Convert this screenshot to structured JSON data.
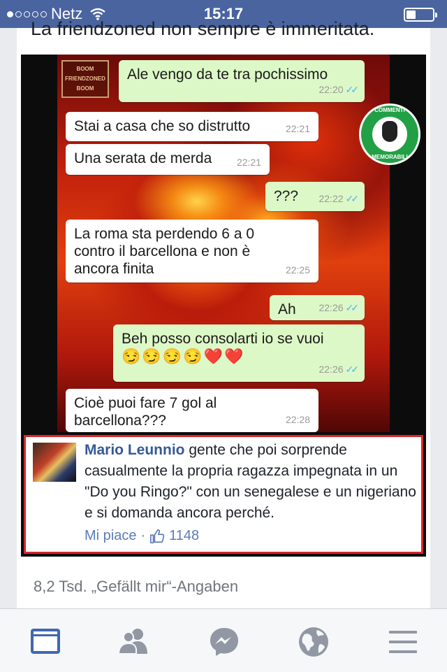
{
  "status_bar": {
    "carrier": "Netz",
    "time": "15:17",
    "signal_bars_filled": 1,
    "signal_bars_total": 5,
    "battery_level": 0.35
  },
  "post": {
    "caption": "La friendzoned non sempre è immeritata."
  },
  "image": {
    "stamp_text": "BOOM FRIENDZONED BOOM",
    "logo_top": "COMMENTI",
    "logo_bottom": "MEMORABILI",
    "messages": [
      {
        "dir": "out",
        "text": "Ale vengo da te tra pochissimo",
        "time": "22:20"
      },
      {
        "dir": "in",
        "text": "Stai a casa che so distrutto",
        "time": "22:21"
      },
      {
        "dir": "in",
        "text": "Una serata de merda",
        "time": "22:21"
      },
      {
        "dir": "out",
        "text": "???",
        "time": "22:22"
      },
      {
        "dir": "in",
        "text": "La roma sta perdendo 6 a 0\ncontro il barcellona e non è\nancora finita",
        "time": "22:25"
      },
      {
        "dir": "out",
        "text": "Ah",
        "time": "22:26"
      },
      {
        "dir": "out",
        "text": "Beh posso consolarti io se vuoi",
        "emojis": "😏😏😏😏❤️❤️",
        "time": "22:26"
      },
      {
        "dir": "in",
        "text": "Cioè puoi fare 7 gol al\nbarcellona???",
        "time": "22:28"
      }
    ]
  },
  "comment": {
    "author": "Mario Leunnio",
    "text": "gente che poi sorprende casualmente la propria ragazza impegnata in un \"Do you Ringo?\" con un senegalese e un nigeriano e si domanda ancora perché.",
    "like_label": "Mi piace",
    "separator": "·",
    "like_count": "1148"
  },
  "footer": {
    "likes_text": "8,2 Tsd. „Gefällt mir“-Angaben"
  },
  "tabbar": {
    "items": [
      {
        "name": "news-feed",
        "active": true
      },
      {
        "name": "friend-requests",
        "active": false
      },
      {
        "name": "messenger",
        "active": false
      },
      {
        "name": "notifications-globe",
        "active": false
      },
      {
        "name": "more-menu",
        "active": false
      }
    ]
  },
  "colors": {
    "facebook_blue": "#4a64a0",
    "link_blue": "#365899",
    "highlight_red": "#d6262c",
    "bubble_out": "#dcf8c6",
    "read_tick": "#4fb6ec"
  }
}
